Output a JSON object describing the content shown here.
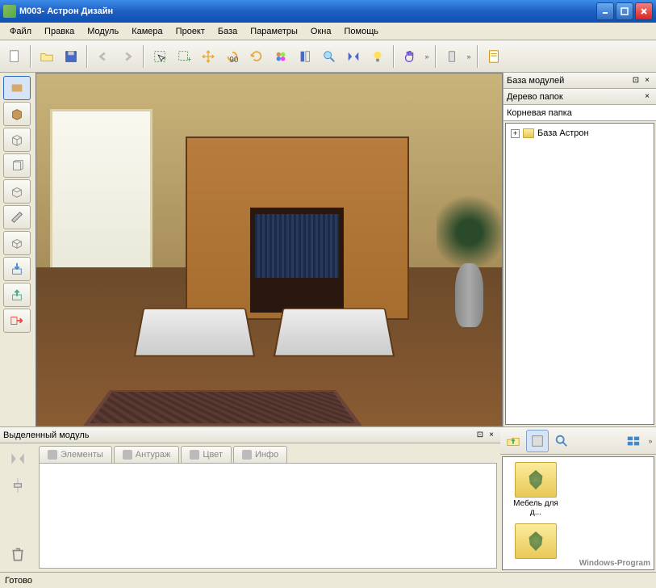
{
  "title": "М003- Астрон Дизайн",
  "menu": [
    "Файл",
    "Правка",
    "Модуль",
    "Камера",
    "Проект",
    "База",
    "Параметры",
    "Окна",
    "Помощь"
  ],
  "right": {
    "panel1": "База модулей",
    "panel2": "Дерево папок",
    "root": "Корневая папка",
    "node1": "База Астрон"
  },
  "selmod": {
    "title": "Выделенный модуль",
    "tabs": [
      "Элементы",
      "Антураж",
      "Цвет",
      "Инфо"
    ]
  },
  "browser": {
    "item1": "Мебель для д..."
  },
  "status": "Готово",
  "watermark": "Windows-Program"
}
